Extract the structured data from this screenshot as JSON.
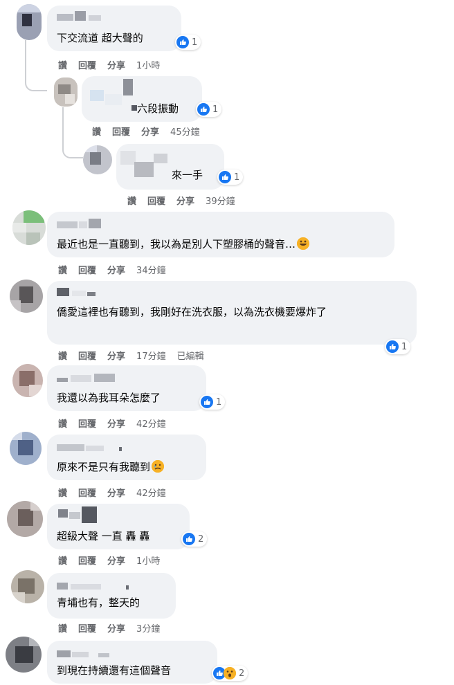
{
  "actions": {
    "like": "讚",
    "reply": "回覆",
    "share": "分享"
  },
  "comments": [
    {
      "text": "下交流道 超大聲的",
      "time": "1小時",
      "reactions": "1"
    },
    {
      "text": "六段振動",
      "time": "45分鐘",
      "reactions": "1"
    },
    {
      "text": "來一手",
      "time": "39分鐘",
      "reactions": "1"
    },
    {
      "text": "最近也是一直聽到，我以為是別人下塑膠桶的聲音…",
      "time": "34分鐘",
      "reactions": ""
    },
    {
      "text": "僑愛這裡也有聽到，我剛好在洗衣服，以為洗衣機要爆炸了",
      "time": "17分鐘",
      "edited": "已編輯",
      "reactions": "1"
    },
    {
      "text": "我還以為我耳朵怎麼了",
      "time": "42分鐘",
      "reactions": "1"
    },
    {
      "text": "原來不是只有我聽到",
      "time": "42分鐘",
      "reactions": ""
    },
    {
      "text": "超級大聲 一直 轟 轟",
      "time": "1小時",
      "reactions": "2"
    },
    {
      "text": "青埔也有，整天的",
      "time": "3分鐘",
      "reactions": ""
    },
    {
      "text": "到現在持續還有這個聲音",
      "time": "",
      "reactions": "2"
    }
  ],
  "colors": {
    "like_blue": "#1877f2",
    "bubble_bg": "#f0f2f5",
    "meta_gray": "#65676b"
  },
  "icons": [
    "like-icon",
    "haha-icon",
    "wow-icon",
    "care-icon"
  ]
}
